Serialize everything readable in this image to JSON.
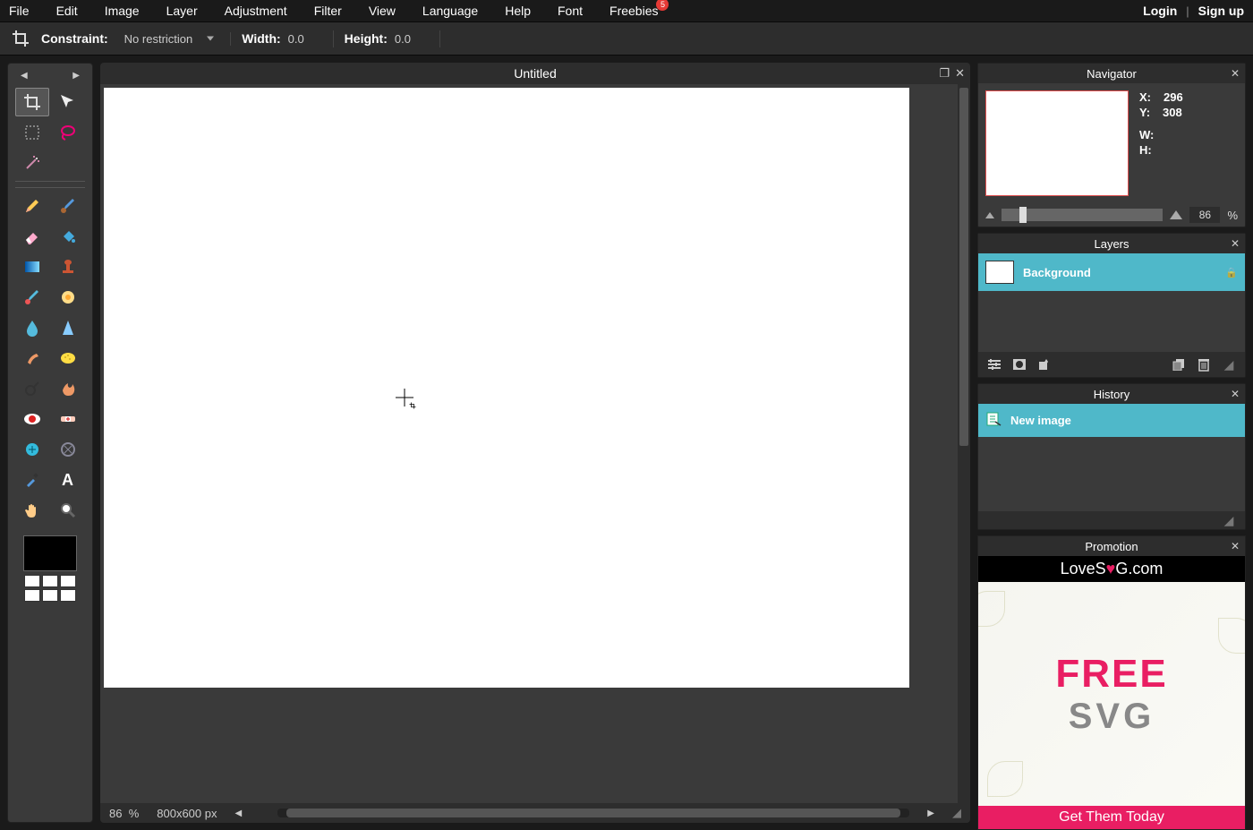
{
  "menubar": {
    "items": [
      "File",
      "Edit",
      "Image",
      "Layer",
      "Adjustment",
      "Filter",
      "View",
      "Language",
      "Help",
      "Font",
      "Freebies"
    ],
    "badge": "5",
    "login": "Login",
    "signup": "Sign up"
  },
  "toolbar": {
    "constraint_label": "Constraint:",
    "constraint_value": "No restriction",
    "width_label": "Width:",
    "width_value": "0.0",
    "height_label": "Height:",
    "height_value": "0.0"
  },
  "tools": [
    {
      "name": "crop-tool",
      "glyph": "crop",
      "active": true
    },
    {
      "name": "move-tool",
      "glyph": "move"
    },
    {
      "name": "marquee-tool",
      "glyph": "marquee"
    },
    {
      "name": "lasso-tool",
      "glyph": "lasso"
    },
    {
      "name": "wand-tool",
      "glyph": "wand"
    },
    {
      "divider": true
    },
    {
      "name": "pencil-tool",
      "glyph": "pencil"
    },
    {
      "name": "brush-tool",
      "glyph": "brush"
    },
    {
      "name": "eraser-tool",
      "glyph": "eraser"
    },
    {
      "name": "bucket-tool",
      "glyph": "bucket"
    },
    {
      "name": "gradient-tool",
      "glyph": "gradient"
    },
    {
      "name": "stamp-tool",
      "glyph": "stamp"
    },
    {
      "name": "colorreplace-tool",
      "glyph": "colorreplace"
    },
    {
      "name": "drawing-tool",
      "glyph": "drawing"
    },
    {
      "name": "blur-tool",
      "glyph": "blur"
    },
    {
      "name": "sharpen-tool",
      "glyph": "sharpen"
    },
    {
      "name": "smudge-tool",
      "glyph": "smudge"
    },
    {
      "name": "sponge-tool",
      "glyph": "sponge"
    },
    {
      "name": "dodge-tool",
      "glyph": "dodge"
    },
    {
      "name": "burn-tool",
      "glyph": "burn"
    },
    {
      "name": "redeye-tool",
      "glyph": "redeye"
    },
    {
      "name": "heal-tool",
      "glyph": "heal"
    },
    {
      "name": "bloat-tool",
      "glyph": "bloat"
    },
    {
      "name": "pinch-tool",
      "glyph": "pinch"
    },
    {
      "name": "picker-tool",
      "glyph": "picker"
    },
    {
      "name": "type-tool",
      "glyph": "type"
    },
    {
      "name": "hand-tool",
      "glyph": "hand"
    },
    {
      "name": "zoom-tool",
      "glyph": "zoom"
    }
  ],
  "document": {
    "title": "Untitled",
    "zoom": "86",
    "pct": "%",
    "dimensions": "800x600 px"
  },
  "navigator": {
    "title": "Navigator",
    "x_label": "X:",
    "x": "296",
    "y_label": "Y:",
    "y": "308",
    "w_label": "W:",
    "w": "",
    "h_label": "H:",
    "h": "",
    "zoom": "86",
    "pct": "%"
  },
  "layers": {
    "title": "Layers",
    "items": [
      {
        "name": "Background",
        "locked": true
      }
    ]
  },
  "history": {
    "title": "History",
    "items": [
      {
        "name": "New image"
      }
    ]
  },
  "promotion": {
    "title": "Promotion",
    "brand_pre": "LoveS",
    "brand_heart": "♥",
    "brand_post": "G.com",
    "line1": "FREE",
    "line2": "SVG",
    "cta": "Get Them Today"
  }
}
